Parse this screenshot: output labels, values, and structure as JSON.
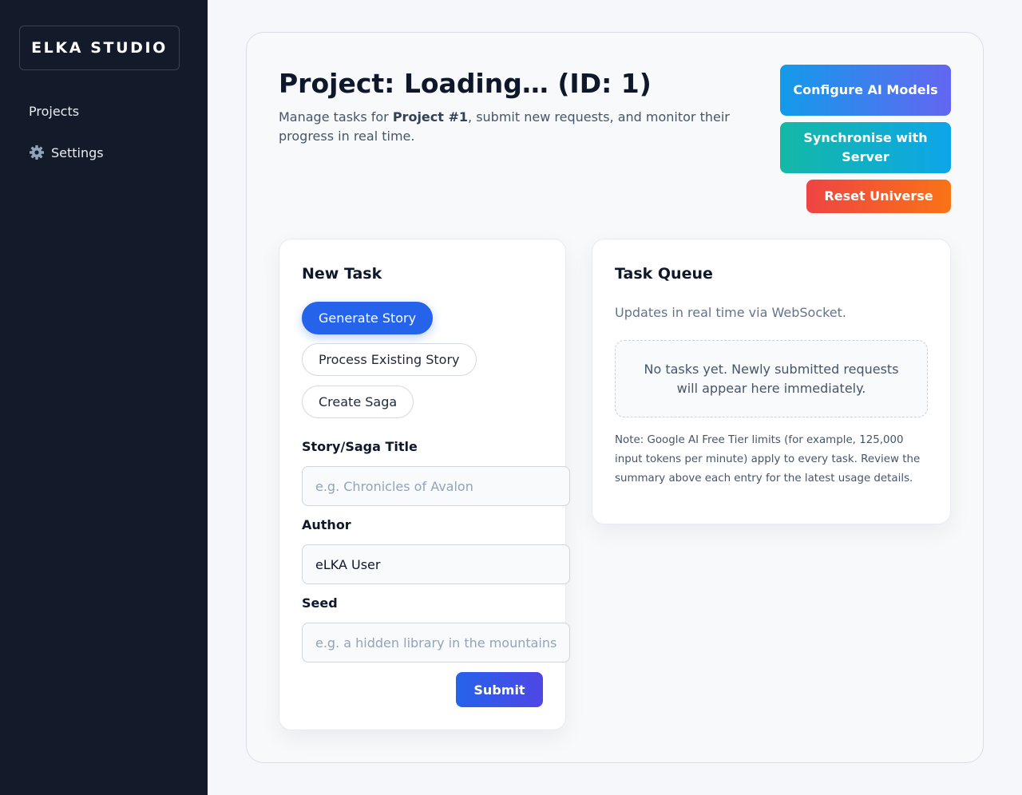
{
  "sidebar": {
    "brand": "ELKA STUDIO",
    "items": [
      {
        "label": "Projects",
        "icon": ""
      },
      {
        "label": "Settings",
        "icon": "gear-icon"
      }
    ]
  },
  "header": {
    "title": "Project: Loading… (ID: 1)",
    "desc_prefix": "Manage tasks for ",
    "desc_bold": "Project #1",
    "desc_suffix": ", submit new requests, and monitor their progress in real time."
  },
  "actions": {
    "configure_label": "Configure AI Models",
    "sync_label": "Synchronise with Server",
    "reset_label": "Reset Universe"
  },
  "new_task": {
    "title": "New Task",
    "modes": [
      "Generate Story",
      "Process Existing Story",
      "Create Saga"
    ],
    "active_mode": "Generate Story",
    "fields": {
      "title_label": "Story/Saga Title",
      "title_placeholder": "e.g. Chronicles of Avalon",
      "author_label": "Author",
      "author_value": "eLKA User",
      "seed_label": "Seed",
      "seed_placeholder": "e.g. a hidden library in the mountains"
    },
    "submit_label": "Submit"
  },
  "queue": {
    "title": "Task Queue",
    "subtitle": "Updates in real time via WebSocket.",
    "empty_message": "No tasks yet. Newly submitted requests will appear here immediately.",
    "note": "Note: Google AI Free Tier limits (for example, 125,000 input tokens per minute) apply to every task. Review the summary above each entry for the latest usage details."
  },
  "colors": {
    "sidebar_bg": "#131a2a",
    "accent": "#2563eb",
    "configure_gradient": [
      "#139bea",
      "#6366f1"
    ],
    "sync_gradient": [
      "#14b8a6",
      "#0ea5e9"
    ],
    "reset_gradient": [
      "#ef4444",
      "#f97316"
    ]
  }
}
